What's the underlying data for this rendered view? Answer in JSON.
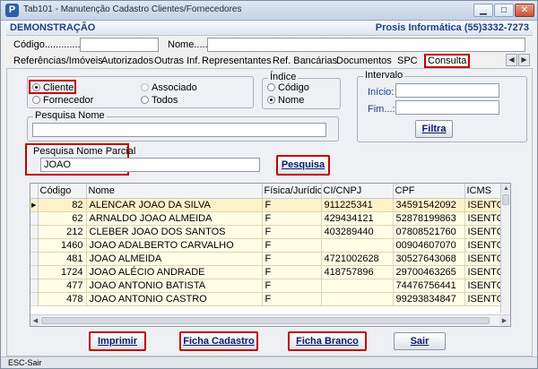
{
  "window": {
    "title": "Tab101 - Manutenção Cadastro Clientes/Fornecedores",
    "app_icon": "P"
  },
  "header": {
    "left": "DEMONSTRAÇÃO",
    "right": "Prosis Informática (55)3332-7273"
  },
  "fields": {
    "codigo_label": "Código...............",
    "codigo_value": "",
    "nome_label": "Nome.....:",
    "nome_value": ""
  },
  "tabs": [
    {
      "label": "Referências/Imóveis"
    },
    {
      "label": "Autorizados"
    },
    {
      "label": "Outras Inf."
    },
    {
      "label": "Representantes"
    },
    {
      "label": "Ref. Bancárias"
    },
    {
      "label": "Documentos"
    },
    {
      "label": "SPC"
    },
    {
      "label": "Consulta",
      "active": true
    }
  ],
  "tipo": {
    "options": [
      {
        "label": "Cliente",
        "selected": true
      },
      {
        "label": "Associado",
        "selected": false
      },
      {
        "label": "Fornecedor",
        "selected": false
      },
      {
        "label": "Todos",
        "selected": false
      }
    ]
  },
  "indice": {
    "title": "Índice",
    "options": [
      {
        "label": "Código",
        "selected": false
      },
      {
        "label": "Nome",
        "selected": true
      }
    ]
  },
  "intervalo": {
    "title": "Intervalo",
    "inicio_label": "Início:",
    "inicio_value": "",
    "fim_label": "Fim...:",
    "fim_value": "",
    "filtra_label": "Filtra"
  },
  "pesquisa_nome": {
    "title": "Pesquisa Nome",
    "value": ""
  },
  "pesquisa_parcial": {
    "title": "Pesquisa Nome Parcial",
    "value": "JOAO",
    "button_label": "Pesquisa"
  },
  "grid": {
    "columns": [
      "Código",
      "Nome",
      "Física/Jurídica",
      "CI/CNPJ",
      "CPF",
      "ICMS"
    ],
    "rows": [
      {
        "codigo": "82",
        "nome": "ALENCAR JOAO DA SILVA",
        "tipo": "F",
        "ci": "911225341",
        "cpf": "34591542092",
        "icms": "ISENTO",
        "selected": true
      },
      {
        "codigo": "62",
        "nome": "ARNALDO JOAO ALMEIDA",
        "tipo": "F",
        "ci": "429434121",
        "cpf": "52878199863",
        "icms": "ISENTO"
      },
      {
        "codigo": "212",
        "nome": "CLEBER JOAO DOS SANTOS",
        "tipo": "F",
        "ci": "403289440",
        "cpf": "07808521760",
        "icms": "ISENTO"
      },
      {
        "codigo": "1460",
        "nome": "JOAO ADALBERTO CARVALHO",
        "tipo": "F",
        "ci": "",
        "cpf": "00904607070",
        "icms": "ISENTO"
      },
      {
        "codigo": "481",
        "nome": "JOAO ALMEIDA",
        "tipo": "F",
        "ci": "4721002628",
        "cpf": "30527643068",
        "icms": "ISENTO"
      },
      {
        "codigo": "1724",
        "nome": "JOAO ALÉCIO ANDRADE",
        "tipo": "F",
        "ci": "418757896",
        "cpf": "29700463265",
        "icms": "ISENTO"
      },
      {
        "codigo": "477",
        "nome": "JOAO ANTONIO BATISTA",
        "tipo": "F",
        "ci": "",
        "cpf": "74476756441",
        "icms": "ISENTO"
      },
      {
        "codigo": "478",
        "nome": "JOAO ANTONIO CASTRO",
        "tipo": "F",
        "ci": "",
        "cpf": "99293834847",
        "icms": "ISENTO"
      }
    ]
  },
  "buttons": {
    "imprimir": "Imprimir",
    "ficha_cadastro": "Ficha Cadastro",
    "ficha_branco": "Ficha Branco",
    "sair": "Sair"
  },
  "status": "ESC-Sair"
}
